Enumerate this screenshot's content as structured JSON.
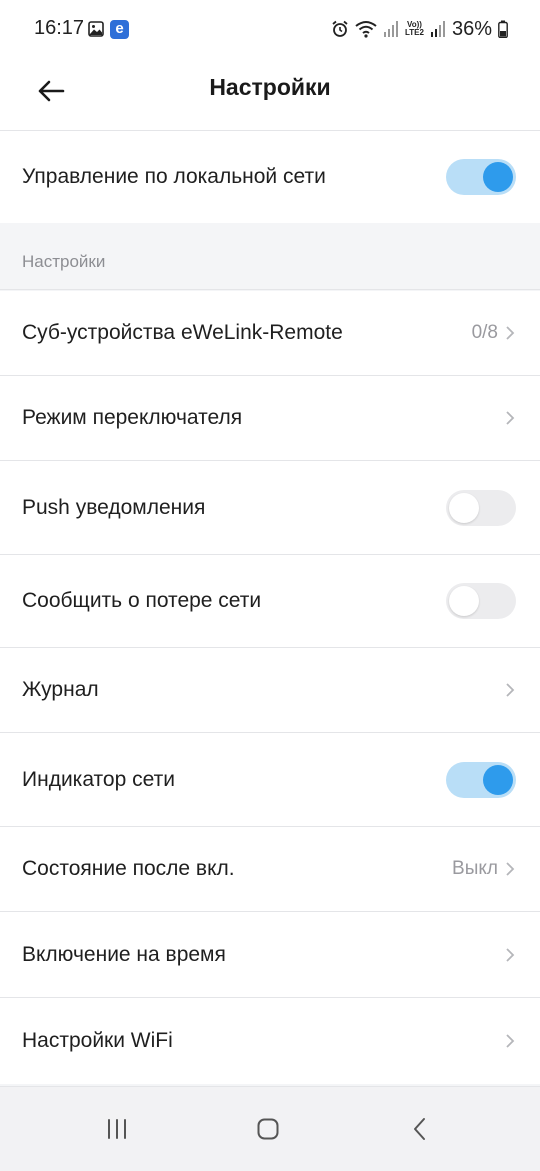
{
  "status_bar": {
    "time": "16:17",
    "notification_icons": [
      "gallery-icon",
      "ewelink-app-icon"
    ],
    "app_badge_letter": "e",
    "right_icons": [
      "alarm-icon",
      "wifi-icon",
      "signal-icon",
      "volte-icon",
      "signal-icon",
      "battery-icon"
    ],
    "volte_line1": "Vo))",
    "volte_line2": "LTE2",
    "battery_percent": "36%"
  },
  "header": {
    "title": "Настройки",
    "back_icon": "arrow-left-icon"
  },
  "local_control": {
    "label": "Управление по локальной сети",
    "enabled": true
  },
  "section": {
    "title": "Настройки"
  },
  "settings": {
    "sub_devices": {
      "label": "Суб-устройства eWeLink-Remote",
      "value": "0/8"
    },
    "switch_mode": {
      "label": "Режим переключателя"
    },
    "push_notifications": {
      "label": "Push уведомления",
      "enabled": false
    },
    "network_loss_report": {
      "label": "Сообщить о потере сети",
      "enabled": false
    },
    "log": {
      "label": "Журнал"
    },
    "network_indicator": {
      "label": "Индикатор сети",
      "enabled": true
    },
    "power_on_state": {
      "label": "Состояние после вкл.",
      "value": "Выкл"
    },
    "timed_on": {
      "label": "Включение на время"
    },
    "wifi_settings": {
      "label": "Настройки WiFi"
    }
  },
  "nav_bar": {
    "buttons": [
      "recent-apps-icon",
      "home-icon",
      "back-icon"
    ]
  },
  "colors": {
    "accent": "#2e9bec",
    "toggle_on_track": "#b9def7",
    "toggle_off_track": "#ececee",
    "background": "#f4f5f7"
  }
}
